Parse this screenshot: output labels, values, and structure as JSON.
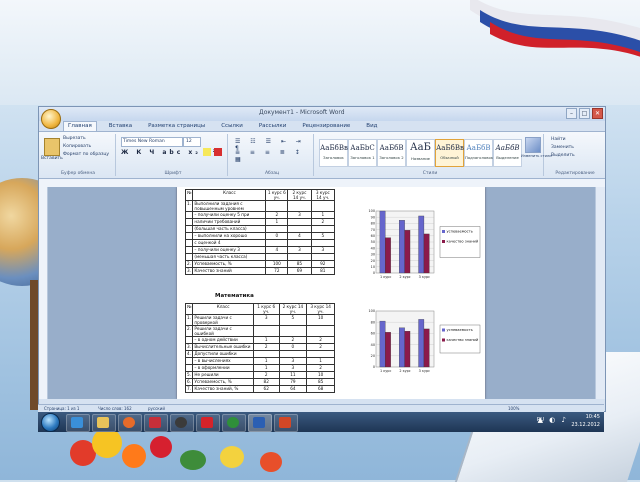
{
  "window": {
    "title": "Документ1 - Microsoft Word",
    "controls": {
      "minimize": "–",
      "maximize": "□",
      "close": "✕"
    }
  },
  "tabs": [
    "Главная",
    "Вставка",
    "Разметка страницы",
    "Ссылки",
    "Рассылки",
    "Рецензирование",
    "Вид"
  ],
  "ribbon": {
    "clipboard": {
      "paste": "Вставить",
      "cut": "Вырезать",
      "copy": "Копировать",
      "format": "Формат по образцу",
      "label": "Буфер обмена"
    },
    "font": {
      "name": "Times New Roman",
      "size": "12",
      "label": "Шрифт"
    },
    "paragraph": {
      "label": "Абзац"
    },
    "styles": {
      "label": "Стили",
      "items": [
        {
          "preview": "АаБбВвГ",
          "name": "Заголовок"
        },
        {
          "preview": "АаБbС",
          "name": "Заголовок 1"
        },
        {
          "preview": "АаБбВ",
          "name": "Заголовок 2"
        },
        {
          "preview": "АаБ",
          "name": "Название"
        },
        {
          "preview": "АаБбВв",
          "name": "Обычный"
        },
        {
          "preview": "АаБбВ",
          "name": "Подзаголовок"
        },
        {
          "preview": "АаБбВ",
          "name": "Выделение"
        }
      ],
      "change": "Изменить стили"
    },
    "editing": {
      "find": "Найти",
      "replace": "Заменить",
      "select": "Выделить",
      "label": "Редактирование"
    }
  },
  "status": {
    "page": "Страница: 1 из 1",
    "words": "Число слов: 162",
    "lang": "русский",
    "zoom": "100%"
  },
  "document": {
    "table1": {
      "headers": [
        "№",
        "Класс",
        "1 курс 6 уч.",
        "2 курс 14 уч.",
        "3 курс 14 уч."
      ],
      "rows": [
        [
          "1.",
          "Выполнили задания с повышенным уровнем",
          "",
          "",
          ""
        ],
        [
          "",
          "– получили оценку 5 при",
          "2",
          "3",
          "1"
        ],
        [
          "",
          "наличии требований",
          "1",
          "",
          "2"
        ],
        [
          "",
          "(большая часть класса)",
          "",
          "",
          ""
        ],
        [
          "",
          "– выполнили на хорошо",
          "0",
          "4",
          "5"
        ],
        [
          "",
          "с оценкой 4",
          "",
          "",
          ""
        ],
        [
          "",
          "– получили оценку 3",
          "4",
          "3",
          "3"
        ],
        [
          "",
          "(меньшая часть класса)",
          "",
          "",
          ""
        ],
        [
          "2.",
          "Успеваемость, %",
          "100",
          "85",
          "92"
        ],
        [
          "3.",
          "Качество знаний",
          "72",
          "69",
          "81"
        ]
      ]
    },
    "section2_title": "Математика",
    "table2": {
      "headers": [
        "№",
        "Класс",
        "1 курс 6 уч.",
        "2 курс 14 уч.",
        "3 курс 14 уч."
      ],
      "rows": [
        [
          "1.",
          "Решили задачи с проверкой",
          "3",
          "5",
          "10"
        ],
        [
          "2.",
          "Решили задачи с ошибкой",
          "",
          "",
          ""
        ],
        [
          "",
          "– в одном действии",
          "1",
          "2",
          "2"
        ],
        [
          "3.",
          "Вычислительные ошибки",
          "2",
          "0",
          "2"
        ],
        [
          "4.",
          "Допустили ошибки",
          "",
          "",
          ""
        ],
        [
          "",
          "– в вычислениях",
          "1",
          "3",
          "1"
        ],
        [
          "",
          "– в оформлении",
          "1",
          "3",
          "2"
        ],
        [
          "5.",
          "Не решили",
          "2",
          "11",
          "10"
        ],
        [
          "6.",
          "Успеваемость, %",
          "82",
          "79",
          "85"
        ],
        [
          "7.",
          "Качество знаний, %",
          "62",
          "64",
          "68"
        ]
      ]
    }
  },
  "chart_data": [
    {
      "type": "bar",
      "categories": [
        "1 курс",
        "2 курс",
        "3 курс"
      ],
      "series": [
        {
          "name": "успеваемость",
          "values": [
            100,
            85,
            92
          ],
          "color": "#6666cc"
        },
        {
          "name": "качество знаний",
          "values": [
            57,
            69,
            63
          ],
          "color": "#8b1a4a"
        }
      ],
      "ylim": [
        0,
        100
      ],
      "yticks": [
        "0",
        "10",
        "20",
        "30",
        "40",
        "50",
        "60",
        "70",
        "80",
        "90",
        "100"
      ],
      "legend": "right",
      "grid": true
    },
    {
      "type": "bar",
      "categories": [
        "1 курс",
        "2 курс",
        "3 курс"
      ],
      "series": [
        {
          "name": "успеваемость",
          "values": [
            82,
            70,
            85
          ],
          "color": "#6666cc"
        },
        {
          "name": "качество знаний",
          "values": [
            62,
            64,
            68
          ],
          "color": "#8b1a4a"
        }
      ],
      "ylim": [
        0,
        100
      ],
      "yticks": [
        "0",
        "20",
        "40",
        "60",
        "80",
        "100"
      ],
      "legend": "right",
      "grid": true
    }
  ],
  "taskbar": {
    "lang": "RU",
    "time": "10:45",
    "date": "23.12.2012",
    "strip": [
      "Страница: 1 из 1",
      "Число слов: 162",
      "русский"
    ]
  }
}
